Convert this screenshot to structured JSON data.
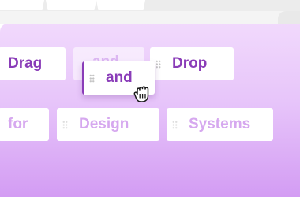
{
  "words": {
    "drag": "Drag",
    "and_ghost": "and",
    "and_dragged": "and",
    "drop": "Drop",
    "for": "for",
    "design": "Design",
    "systems": "Systems"
  },
  "colors": {
    "canvas_top": "#f1d9fc",
    "canvas_bottom": "#d39cf3",
    "text_active": "#8a3cb8",
    "text_faded": "#d6a8ef"
  },
  "icons": {
    "grip": "drag-handle-icon",
    "cursor": "grabbing-hand-cursor-icon"
  }
}
